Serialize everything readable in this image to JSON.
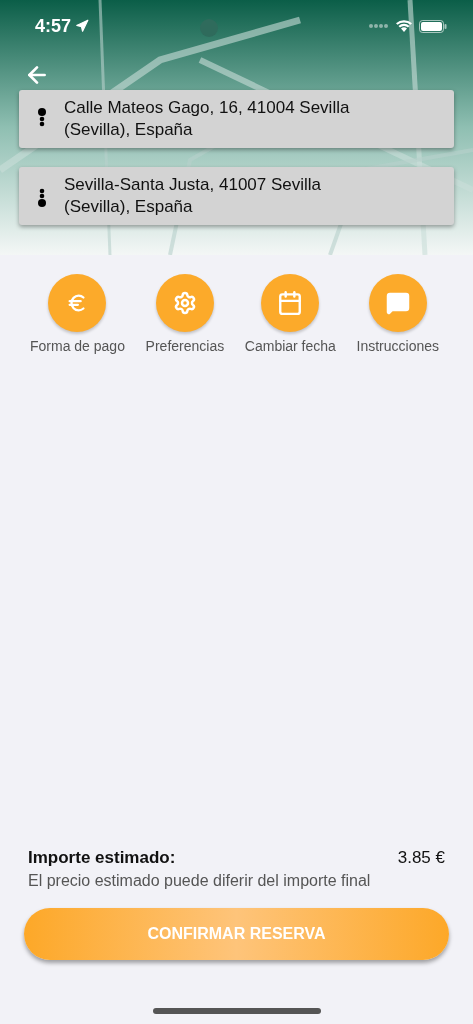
{
  "status_bar": {
    "time": "4:57"
  },
  "route": [
    {
      "kind": "origin",
      "address": "Calle Mateos Gago, 16, 41004 Sevilla (Sevilla), España"
    },
    {
      "kind": "destination",
      "address": "Sevilla-Santa Justa, 41007 Sevilla (Sevilla), España"
    }
  ],
  "actions": [
    {
      "kind": "payment",
      "label": "Forma de pago"
    },
    {
      "kind": "settings",
      "label": "Preferencias"
    },
    {
      "kind": "calendar",
      "label": "Cambiar fecha"
    },
    {
      "kind": "message",
      "label": "Instrucciones"
    }
  ],
  "estimate": {
    "label": "Importe estimado:",
    "price": "3.85 €",
    "note": "El precio estimado puede diferir del importe final"
  },
  "confirm_button": "CONFIRMAR RESERVA"
}
